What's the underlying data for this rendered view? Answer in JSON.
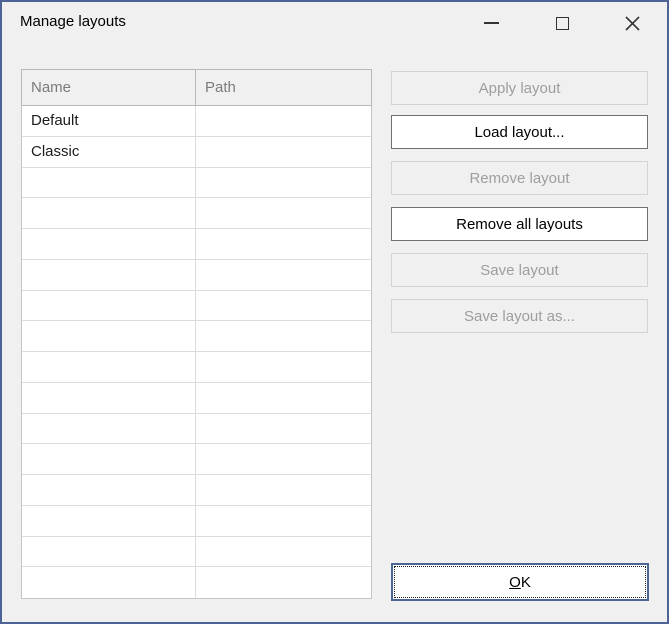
{
  "window": {
    "title": "Manage layouts"
  },
  "titlebar_controls": {
    "minimize": "minimize-icon",
    "maximize": "maximize-icon",
    "close": "close-icon"
  },
  "table": {
    "columns": [
      "Name",
      "Path"
    ],
    "rows": [
      {
        "name": "Default",
        "path": ""
      },
      {
        "name": "Classic",
        "path": ""
      },
      {
        "name": "",
        "path": ""
      },
      {
        "name": "",
        "path": ""
      },
      {
        "name": "",
        "path": ""
      },
      {
        "name": "",
        "path": ""
      },
      {
        "name": "",
        "path": ""
      },
      {
        "name": "",
        "path": ""
      },
      {
        "name": "",
        "path": ""
      },
      {
        "name": "",
        "path": ""
      },
      {
        "name": "",
        "path": ""
      },
      {
        "name": "",
        "path": ""
      },
      {
        "name": "",
        "path": ""
      },
      {
        "name": "",
        "path": ""
      },
      {
        "name": "",
        "path": ""
      },
      {
        "name": "",
        "path": ""
      }
    ]
  },
  "side_buttons": [
    {
      "label": "Apply layout",
      "enabled": false
    },
    {
      "label": "Load layout...",
      "enabled": true
    },
    {
      "label": "Remove layout",
      "enabled": false
    },
    {
      "label": "Remove all layouts",
      "enabled": true
    },
    {
      "label": "Save layout",
      "enabled": false
    },
    {
      "label": "Save layout as...",
      "enabled": false
    }
  ],
  "ok_button": {
    "mnemonic": "O",
    "rest": "K"
  },
  "colors": {
    "accent_border": "#4e6497",
    "dialog_bg": "#f0f0f0",
    "disabled_text": "#9e9e9e",
    "enabled_button_border": "#707070",
    "grid_line": "#dcdcdc",
    "header_border": "#b9b9b9",
    "header_text": "#7b7b7b"
  }
}
